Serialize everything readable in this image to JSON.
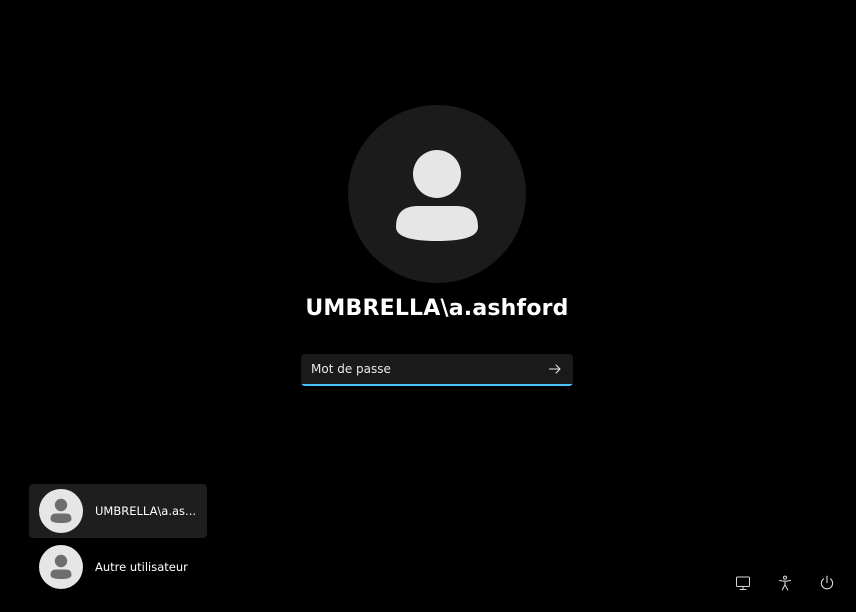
{
  "login": {
    "username": "UMBRELLA\\a.ashford",
    "password_placeholder": "Mot de passe",
    "password_value": "",
    "submit_icon": "arrow-right-icon"
  },
  "user_list": {
    "items": [
      {
        "label": "UMBRELLA\\a.as...",
        "selected": true,
        "icon": "user-avatar-icon"
      },
      {
        "label": "Autre utilisateur",
        "selected": false,
        "icon": "user-avatar-icon"
      }
    ]
  },
  "system_buttons": [
    {
      "icon": "network-icon"
    },
    {
      "icon": "accessibility-icon"
    },
    {
      "icon": "power-icon"
    }
  ],
  "colors": {
    "background": "#000000",
    "avatar_circle": "#1b1b1b",
    "avatar_figure": "#e6e6e6",
    "input_background": "#1a1a1a",
    "input_accent": "#4cc2ff",
    "selected_tile": "#1e1e1e",
    "text": "#ffffff"
  }
}
